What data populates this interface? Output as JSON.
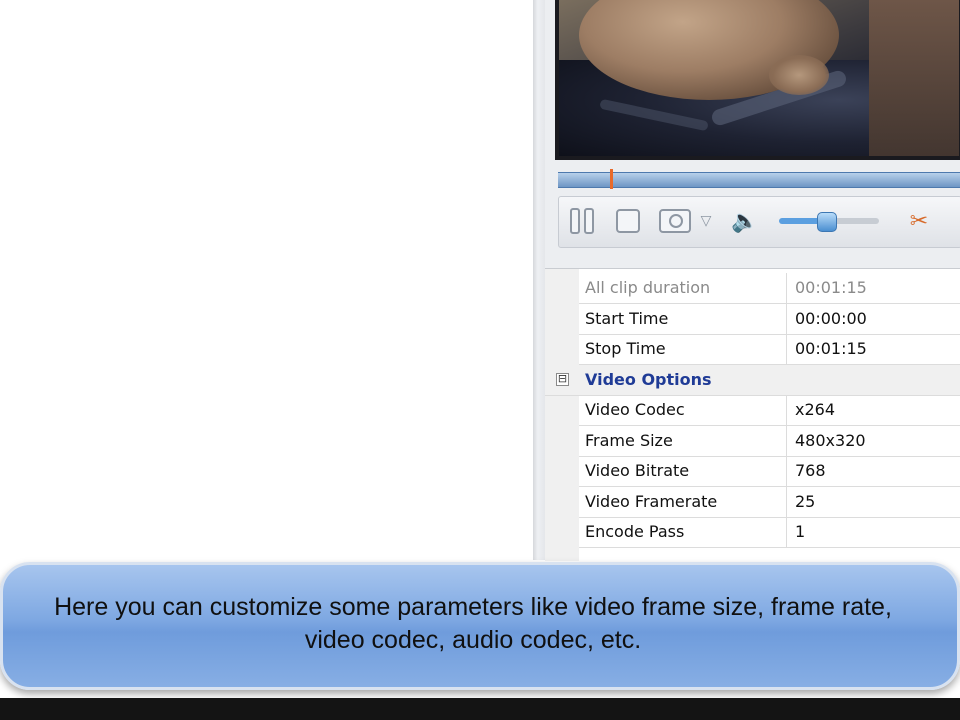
{
  "player": {
    "controls": {
      "pause_icon": "pause-icon",
      "stop_icon": "stop-icon",
      "snapshot_icon": "camera-icon",
      "volume_icon": "volume-icon",
      "trim_icon": "scissors-icon",
      "volume_level": 0.48
    },
    "seek_position": 0.13
  },
  "properties": {
    "rows_top": [
      {
        "name": "All clip duration",
        "value": "00:01:15",
        "disabled": true
      },
      {
        "name": "Start Time",
        "value": "00:00:00"
      },
      {
        "name": "Stop Time",
        "value": "00:01:15"
      }
    ],
    "category": {
      "label": "Video Options",
      "toggle": "⊟"
    },
    "rows_video": [
      {
        "name": "Video Codec",
        "value": "x264"
      },
      {
        "name": "Frame Size",
        "value": "480x320"
      },
      {
        "name": "Video Bitrate",
        "value": "768"
      },
      {
        "name": "Video Framerate",
        "value": "25"
      },
      {
        "name": "Encode Pass",
        "value": "1"
      }
    ]
  },
  "caption": {
    "line1": "Here you can customize some parameters like video frame size, frame rate,",
    "line2": "video codec, audio codec, etc."
  },
  "colors": {
    "seek_marker": "#e86a2a",
    "category_text": "#1f3b96",
    "caption_bg": "#7ea8e2"
  }
}
